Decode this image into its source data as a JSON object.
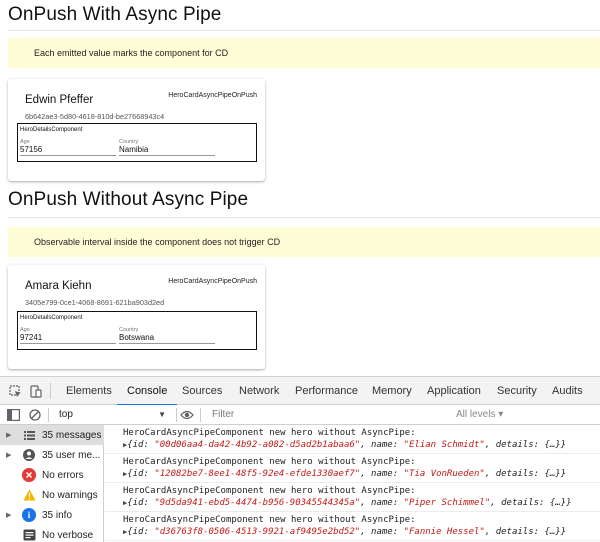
{
  "sections": [
    {
      "title": "OnPush With Async Pipe",
      "banner": "Each emitted value marks the component for CD",
      "card": {
        "hero_name": "Edwin Pfeffer",
        "component_tag": "HeroCardAsyncPipeOnPush",
        "hero_id": "6b642ae3-5d80-4618-810d-be27668943c4",
        "details_label": "HeroDetailsComponent",
        "age_label": "Age",
        "age_value": "57156",
        "country_label": "Country",
        "country_value": "Namibia"
      }
    },
    {
      "title": "OnPush Without Async Pipe",
      "banner": "Observable interval inside the component does not trigger CD",
      "card": {
        "hero_name": "Amara Kiehn",
        "component_tag": "HeroCardAsyncPipeOnPush",
        "hero_id": "3405e799-0ce1-4068-8691-621ba903d2ed",
        "details_label": "HeroDetailsComponent",
        "age_label": "Age",
        "age_value": "97241",
        "country_label": "Country",
        "country_value": "Botswana"
      }
    }
  ],
  "devtools": {
    "tabs": [
      "Elements",
      "Console",
      "Sources",
      "Network",
      "Performance",
      "Memory",
      "Application",
      "Security",
      "Audits"
    ],
    "active_tab": "Console",
    "context": "top",
    "filter_placeholder": "Filter",
    "levels": "All levels ▾",
    "sidebar": [
      {
        "label": "35 messages",
        "icon": "list-icon",
        "selected": true
      },
      {
        "label": "35 user me...",
        "icon": "user-icon",
        "selected": false
      },
      {
        "label": "No errors",
        "icon": "error-icon",
        "selected": false
      },
      {
        "label": "No warnings",
        "icon": "warning-icon",
        "selected": false
      },
      {
        "label": "35 info",
        "icon": "info-icon",
        "selected": false
      },
      {
        "label": "No verbose",
        "icon": "verbose-icon",
        "selected": false
      }
    ],
    "logs": [
      {
        "message": "HeroCardAsyncPipeComponent new hero without AsyncPipe:",
        "id": "\"00d06aa4-da42-4b92-a082-d5ad2b1abaa6\"",
        "name": "\"Elian Schmidt\""
      },
      {
        "message": "HeroCardAsyncPipeComponent new hero without AsyncPipe:",
        "id": "\"12082be7-8ee1-48f5-92e4-efde1330aef7\"",
        "name": "\"Tia VonRueden\""
      },
      {
        "message": "HeroCardAsyncPipeComponent new hero without AsyncPipe:",
        "id": "\"9d5da941-ebd5-4474-b956-90345544345a\"",
        "name": "\"Piper Schimmel\""
      },
      {
        "message": "HeroCardAsyncPipeComponent new hero without AsyncPipe:",
        "id": "\"d36763f8-0506-4513-9921-af9495e2bd52\"",
        "name": "\"Fannie Hessel\""
      }
    ],
    "log_labels": {
      "open": "{id: ",
      "name_key": ", name: ",
      "details": ", details: ",
      "details_val": "{…}",
      "close": "}"
    }
  }
}
